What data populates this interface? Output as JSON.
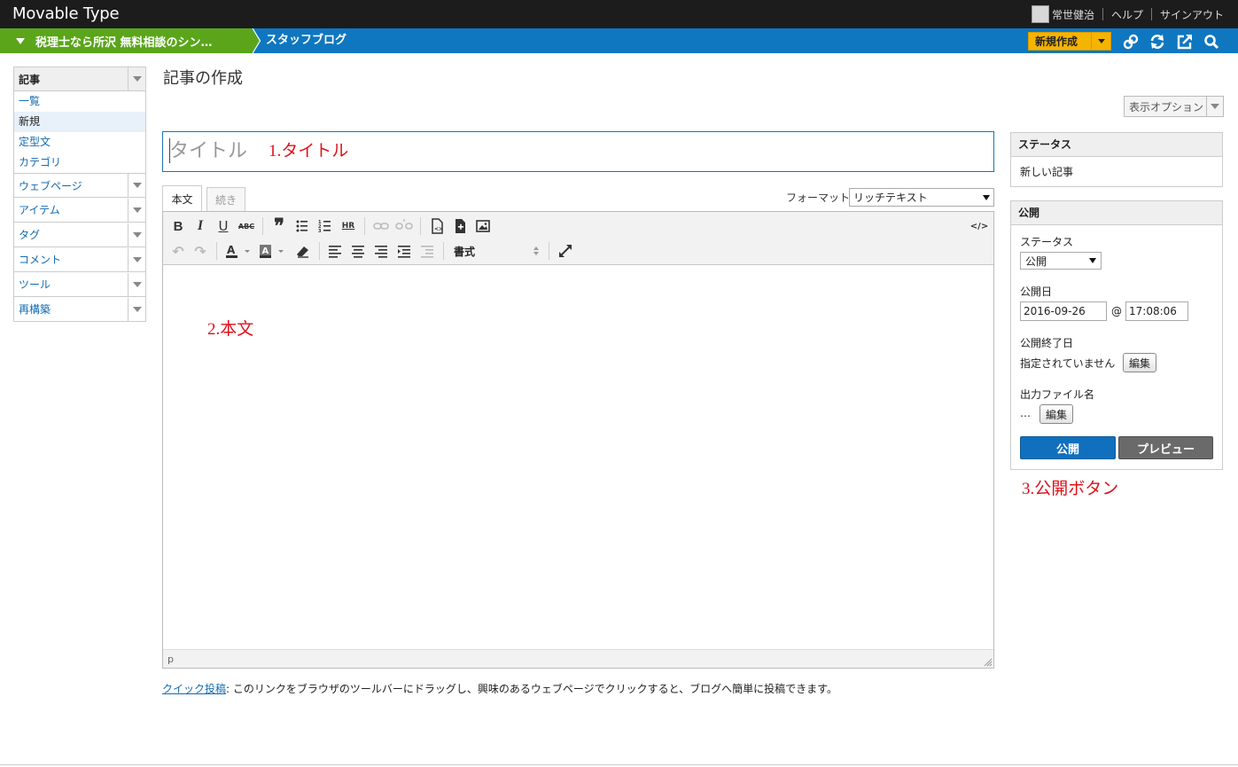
{
  "header": {
    "app_title": "Movable Type",
    "user_name": "常世健治",
    "help": "ヘルプ",
    "signout": "サインアウト"
  },
  "sitebar": {
    "site_name": "税理士なら所沢 無料相談のシン…",
    "blog_name": "スタッフブログ",
    "new_button": "新規作成"
  },
  "sidebar": {
    "sections": [
      {
        "label": "記事",
        "items": [
          "一覧",
          "新規",
          "定型文",
          "カテゴリ"
        ],
        "active_item": "新規"
      },
      {
        "label": "ウェブページ"
      },
      {
        "label": "アイテム"
      },
      {
        "label": "タグ"
      },
      {
        "label": "コメント"
      },
      {
        "label": "ツール"
      },
      {
        "label": "再構築"
      }
    ]
  },
  "main": {
    "page_title": "記事の作成",
    "display_options": "表示オプション",
    "title_placeholder": "タイトル",
    "tabs": [
      "本文",
      "続き"
    ],
    "format_label": "フォーマット:",
    "format_value": "リッチテキスト",
    "paragraph_format": "書式",
    "status_path": "p",
    "quickpost_link": "クイック投稿",
    "quickpost_text": ": このリンクをブラウザのツールバーにドラッグし、興味のあるウェブページでクリックすると、ブログへ簡単に投稿できます。"
  },
  "annotations": {
    "title": "1.タイトル",
    "body": "2.本文",
    "publish": "3.公開ボタン",
    "color": "#e0101a"
  },
  "status_widget": {
    "heading": "ステータス",
    "value": "新しい記事"
  },
  "publish_widget": {
    "heading": "公開",
    "status_label": "ステータス",
    "status_value": "公開",
    "date_label": "公開日",
    "date_value": "2016-09-26",
    "at": "@",
    "time_value": "17:08:06",
    "end_label": "公開終了日",
    "end_value": "指定されていません",
    "edit": "編集",
    "filename_label": "出力ファイル名",
    "filename_value": "…",
    "publish_button": "公開",
    "preview_button": "プレビュー"
  },
  "colors": {
    "topbar": "#1c1c1c",
    "sitebar": "#0f77c0",
    "site_green": "#5aa51a",
    "new_button": "#f5b400",
    "publish_button": "#1170bd",
    "preview_button": "#6a6a6a",
    "link": "#136bb0"
  }
}
